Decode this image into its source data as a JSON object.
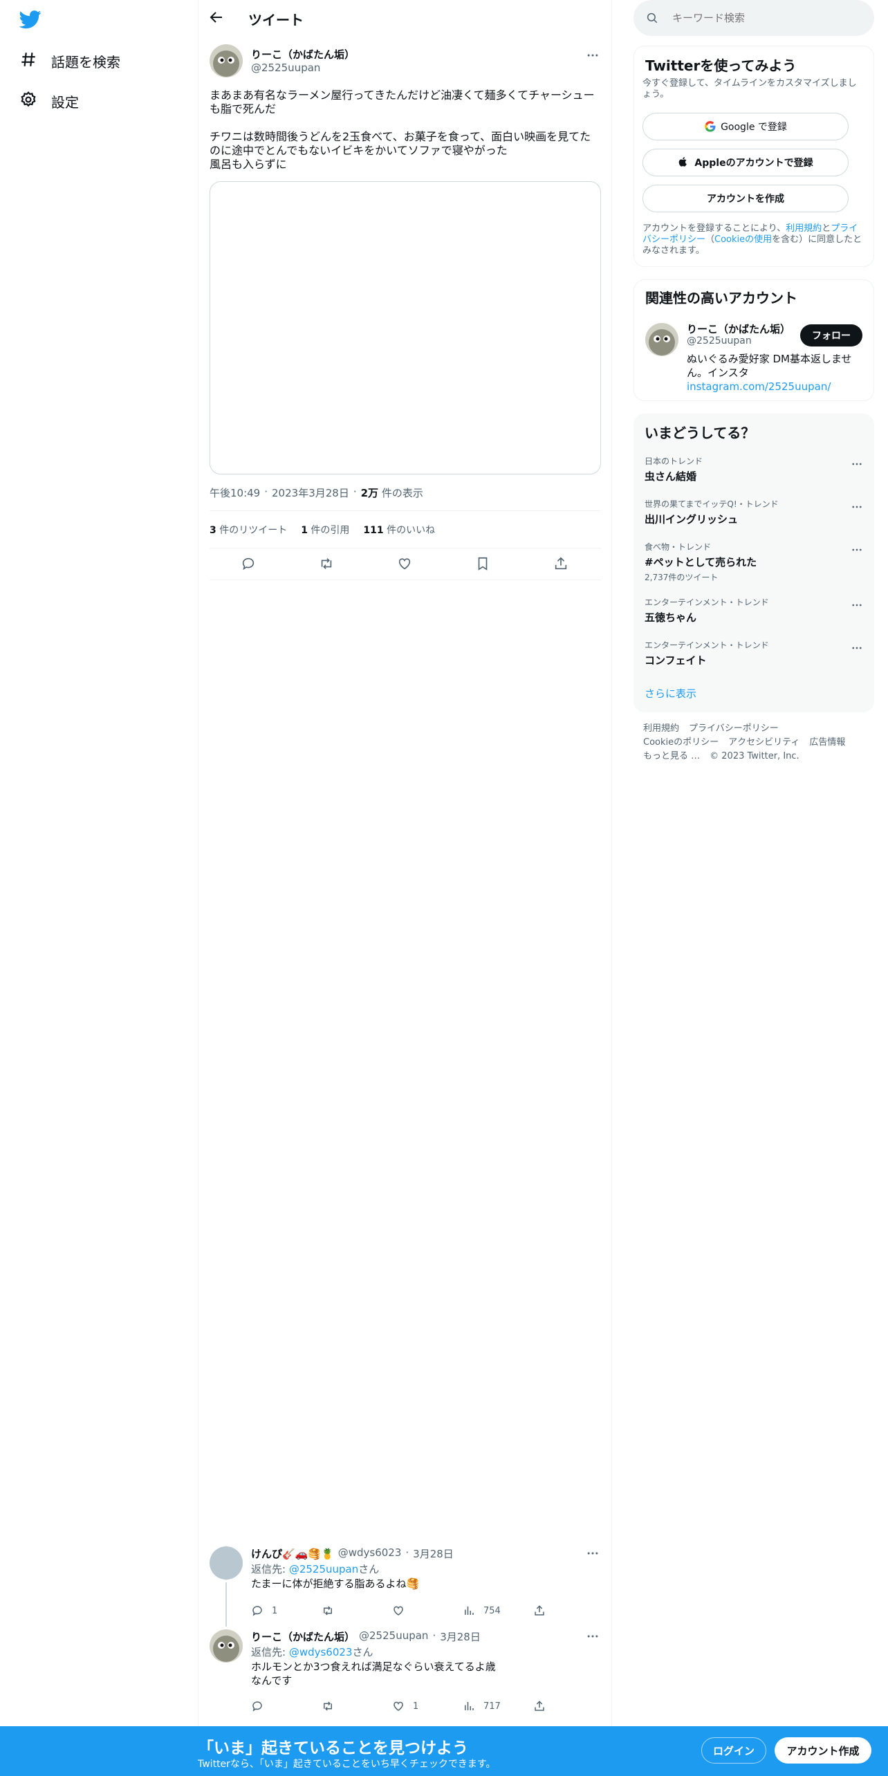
{
  "colors": {
    "accent": "#1d9bf0",
    "text": "#0f1419",
    "muted": "#536471",
    "border": "#eff3f4"
  },
  "nav": {
    "logo_icon": "twitter-bird-icon",
    "items": [
      {
        "label": "話題を検索",
        "icon": "hashtag-icon"
      },
      {
        "label": "設定",
        "icon": "gear-icon"
      }
    ]
  },
  "header": {
    "title": "ツイート"
  },
  "tweet": {
    "name": "りーこ（かばたん垢）",
    "handle": "@2525uupan",
    "text1": "まあまあ有名なラーメン屋行ってきたんだけど油凄くて麺多くてチャーシューも脂で死んだ",
    "text2": "チワニは数時間後うどんを2玉食べて、お菓子を食って、面白い映画を見てたのに途中でとんでもないイビキをかいてソファで寝やがった",
    "text3": "風呂も入らずに",
    "time": "午後10:49",
    "date": "2023年3月28日",
    "views_count": "2万",
    "views_label": "件の表示",
    "retweets_count": "3",
    "retweets_label": "件のリツイート",
    "quotes_count": "1",
    "quotes_label": "件の引用",
    "likes_count": "111",
    "likes_label": "件のいいね"
  },
  "replies": [
    {
      "name": "けんぴ🎸🚗🥞🍍",
      "handle": "@wdys6023",
      "date": "3月28日",
      "reply_to_prefix": "返信先: ",
      "reply_to": "@2525uupan",
      "reply_to_suffix": "さん",
      "text": "たまーに体が拒絶する脂あるよね🥞",
      "replies": "1",
      "retweets": "",
      "likes": "",
      "views": "754"
    },
    {
      "name": "りーこ（かばたん垢）",
      "handle": "@2525uupan",
      "date": "3月28日",
      "reply_to_prefix": "返信先: ",
      "reply_to": "@wdys6023",
      "reply_to_suffix": "さん",
      "text": "ホルモンとか3つ食えれば満足なぐらい衰えてるよ歳なんです",
      "replies": "",
      "retweets": "",
      "likes": "1",
      "views": "717"
    }
  ],
  "search": {
    "placeholder": "キーワード検索"
  },
  "signup": {
    "title": "Twitterを使ってみよう",
    "sub": "今すぐ登録して、タイムラインをカスタマイズしましょう。",
    "google": "Google で登録",
    "apple": "Appleのアカウントで登録",
    "create": "アカウントを作成",
    "legal_1": "アカウントを登録することにより、",
    "legal_terms": "利用規約",
    "legal_and": "と",
    "legal_privacy": "プライバシーポリシー",
    "legal_paren_open": "（",
    "legal_cookie": "Cookieの使用",
    "legal_rest": "を含む）に同意したとみなされます。"
  },
  "related": {
    "title": "関連性の高いアカウント",
    "name": "りーこ（かばたん垢）",
    "handle": "@2525uupan",
    "follow": "フォロー",
    "bio": "ぬいぐるみ愛好家 DM基本返しません。インスタ",
    "bio_link": "instagram.com/2525uupan/"
  },
  "trends": {
    "title": "いまどうしてる？",
    "items": [
      {
        "context": "日本のトレンド",
        "title": "虫さん結婚",
        "count": ""
      },
      {
        "context": "世界の果てまでイッテQ!・トレンド",
        "title": "出川イングリッシュ",
        "count": ""
      },
      {
        "context": "食べ物・トレンド",
        "title": "#ペットとして売られた",
        "count": "2,737件のツイート"
      },
      {
        "context": "エンターテインメント・トレンド",
        "title": "五徳ちゃん",
        "count": ""
      },
      {
        "context": "エンターテインメント・トレンド",
        "title": "コンフェイト",
        "count": ""
      }
    ],
    "show_more": "さらに表示"
  },
  "footer": {
    "links": [
      "利用規約",
      "プライバシーポリシー",
      "Cookieのポリシー",
      "アクセシビリティ",
      "広告情報",
      "もっと見る …"
    ],
    "copyright": "© 2023 Twitter, Inc."
  },
  "bottom": {
    "title": "「いま」起きていることを見つけよう",
    "sub": "Twitterなら、「いま」起きていることをいち早くチェックできます。",
    "login": "ログイン",
    "signup": "アカウント作成"
  }
}
